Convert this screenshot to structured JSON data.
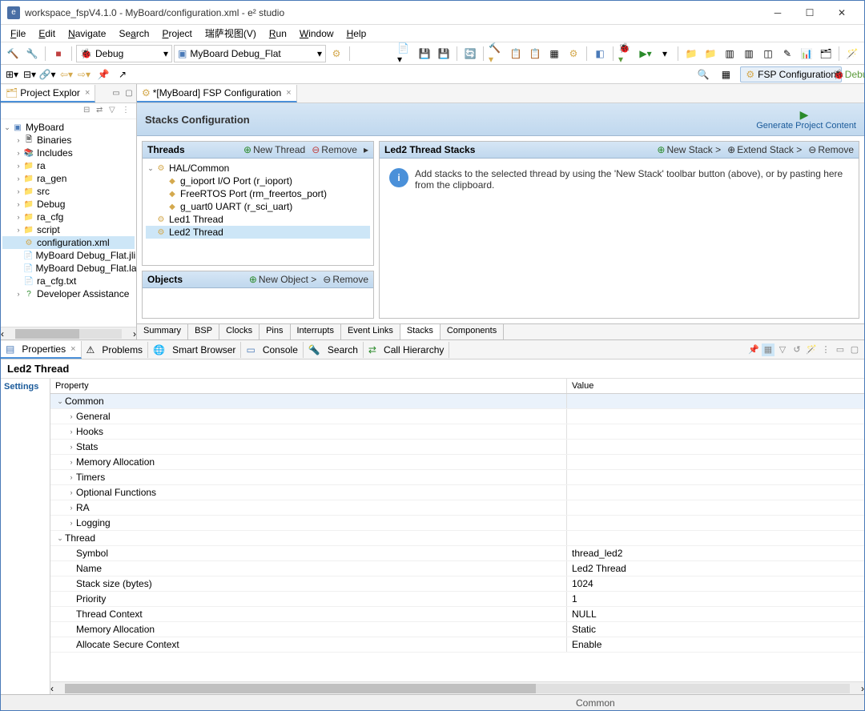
{
  "window": {
    "title": "workspace_fspV4.1.0 - MyBoard/configuration.xml - e² studio"
  },
  "menu": {
    "file": "File",
    "edit": "Edit",
    "navigate": "Navigate",
    "search": "Search",
    "project": "Project",
    "renesas": "瑞萨视图(V)",
    "run": "Run",
    "window": "Window",
    "help": "Help"
  },
  "toolbar": {
    "debug_combo": "Debug",
    "launch_combo": "MyBoard Debug_Flat"
  },
  "persp": {
    "fsp": "FSP Configuration",
    "debug": "Debug"
  },
  "explorer": {
    "tab": "Project Explor",
    "root": "MyBoard",
    "items": [
      "Binaries",
      "Includes",
      "ra",
      "ra_gen",
      "src",
      "Debug",
      "ra_cfg",
      "script"
    ],
    "files": [
      "configuration.xml",
      "MyBoard Debug_Flat.jli",
      "MyBoard Debug_Flat.la",
      "ra_cfg.txt"
    ],
    "assist": "Developer Assistance"
  },
  "editor": {
    "tab": "*[MyBoard] FSP Configuration",
    "title": "Stacks Configuration",
    "gen": "Generate Project Content",
    "threads": {
      "title": "Threads",
      "new": "New Thread",
      "remove": "Remove",
      "root": "HAL/Common",
      "items": [
        "g_ioport I/O Port (r_ioport)",
        "FreeRTOS Port (rm_freertos_port)",
        "g_uart0 UART (r_sci_uart)"
      ],
      "t1": "Led1 Thread",
      "t2": "Led2 Thread"
    },
    "objects": {
      "title": "Objects",
      "new": "New Object >",
      "remove": "Remove"
    },
    "stacks": {
      "title": "Led2 Thread Stacks",
      "new": "New Stack >",
      "extend": "Extend Stack >",
      "remove": "Remove",
      "msg": "Add stacks to the selected thread by using the 'New Stack' toolbar button (above), or by pasting here from the clipboard."
    },
    "tabs": [
      "Summary",
      "BSP",
      "Clocks",
      "Pins",
      "Interrupts",
      "Event Links",
      "Stacks",
      "Components"
    ]
  },
  "views": {
    "props": "Properties",
    "problems": "Problems",
    "smart": "Smart Browser",
    "console": "Console",
    "search": "Search",
    "call": "Call Hierarchy"
  },
  "props": {
    "title": "Led2 Thread",
    "side": "Settings",
    "head_prop": "Property",
    "head_val": "Value",
    "common": "Common",
    "common_items": [
      "General",
      "Hooks",
      "Stats",
      "Memory Allocation",
      "Timers",
      "Optional Functions",
      "RA",
      "Logging"
    ],
    "thread": "Thread",
    "thread_rows": [
      {
        "k": "Symbol",
        "v": "thread_led2"
      },
      {
        "k": "Name",
        "v": "Led2 Thread"
      },
      {
        "k": "Stack size (bytes)",
        "v": "1024"
      },
      {
        "k": "Priority",
        "v": "1"
      },
      {
        "k": "Thread Context",
        "v": "NULL"
      },
      {
        "k": "Memory Allocation",
        "v": "Static"
      },
      {
        "k": "Allocate Secure Context",
        "v": "Enable"
      }
    ]
  },
  "status": {
    "right": "Common"
  }
}
